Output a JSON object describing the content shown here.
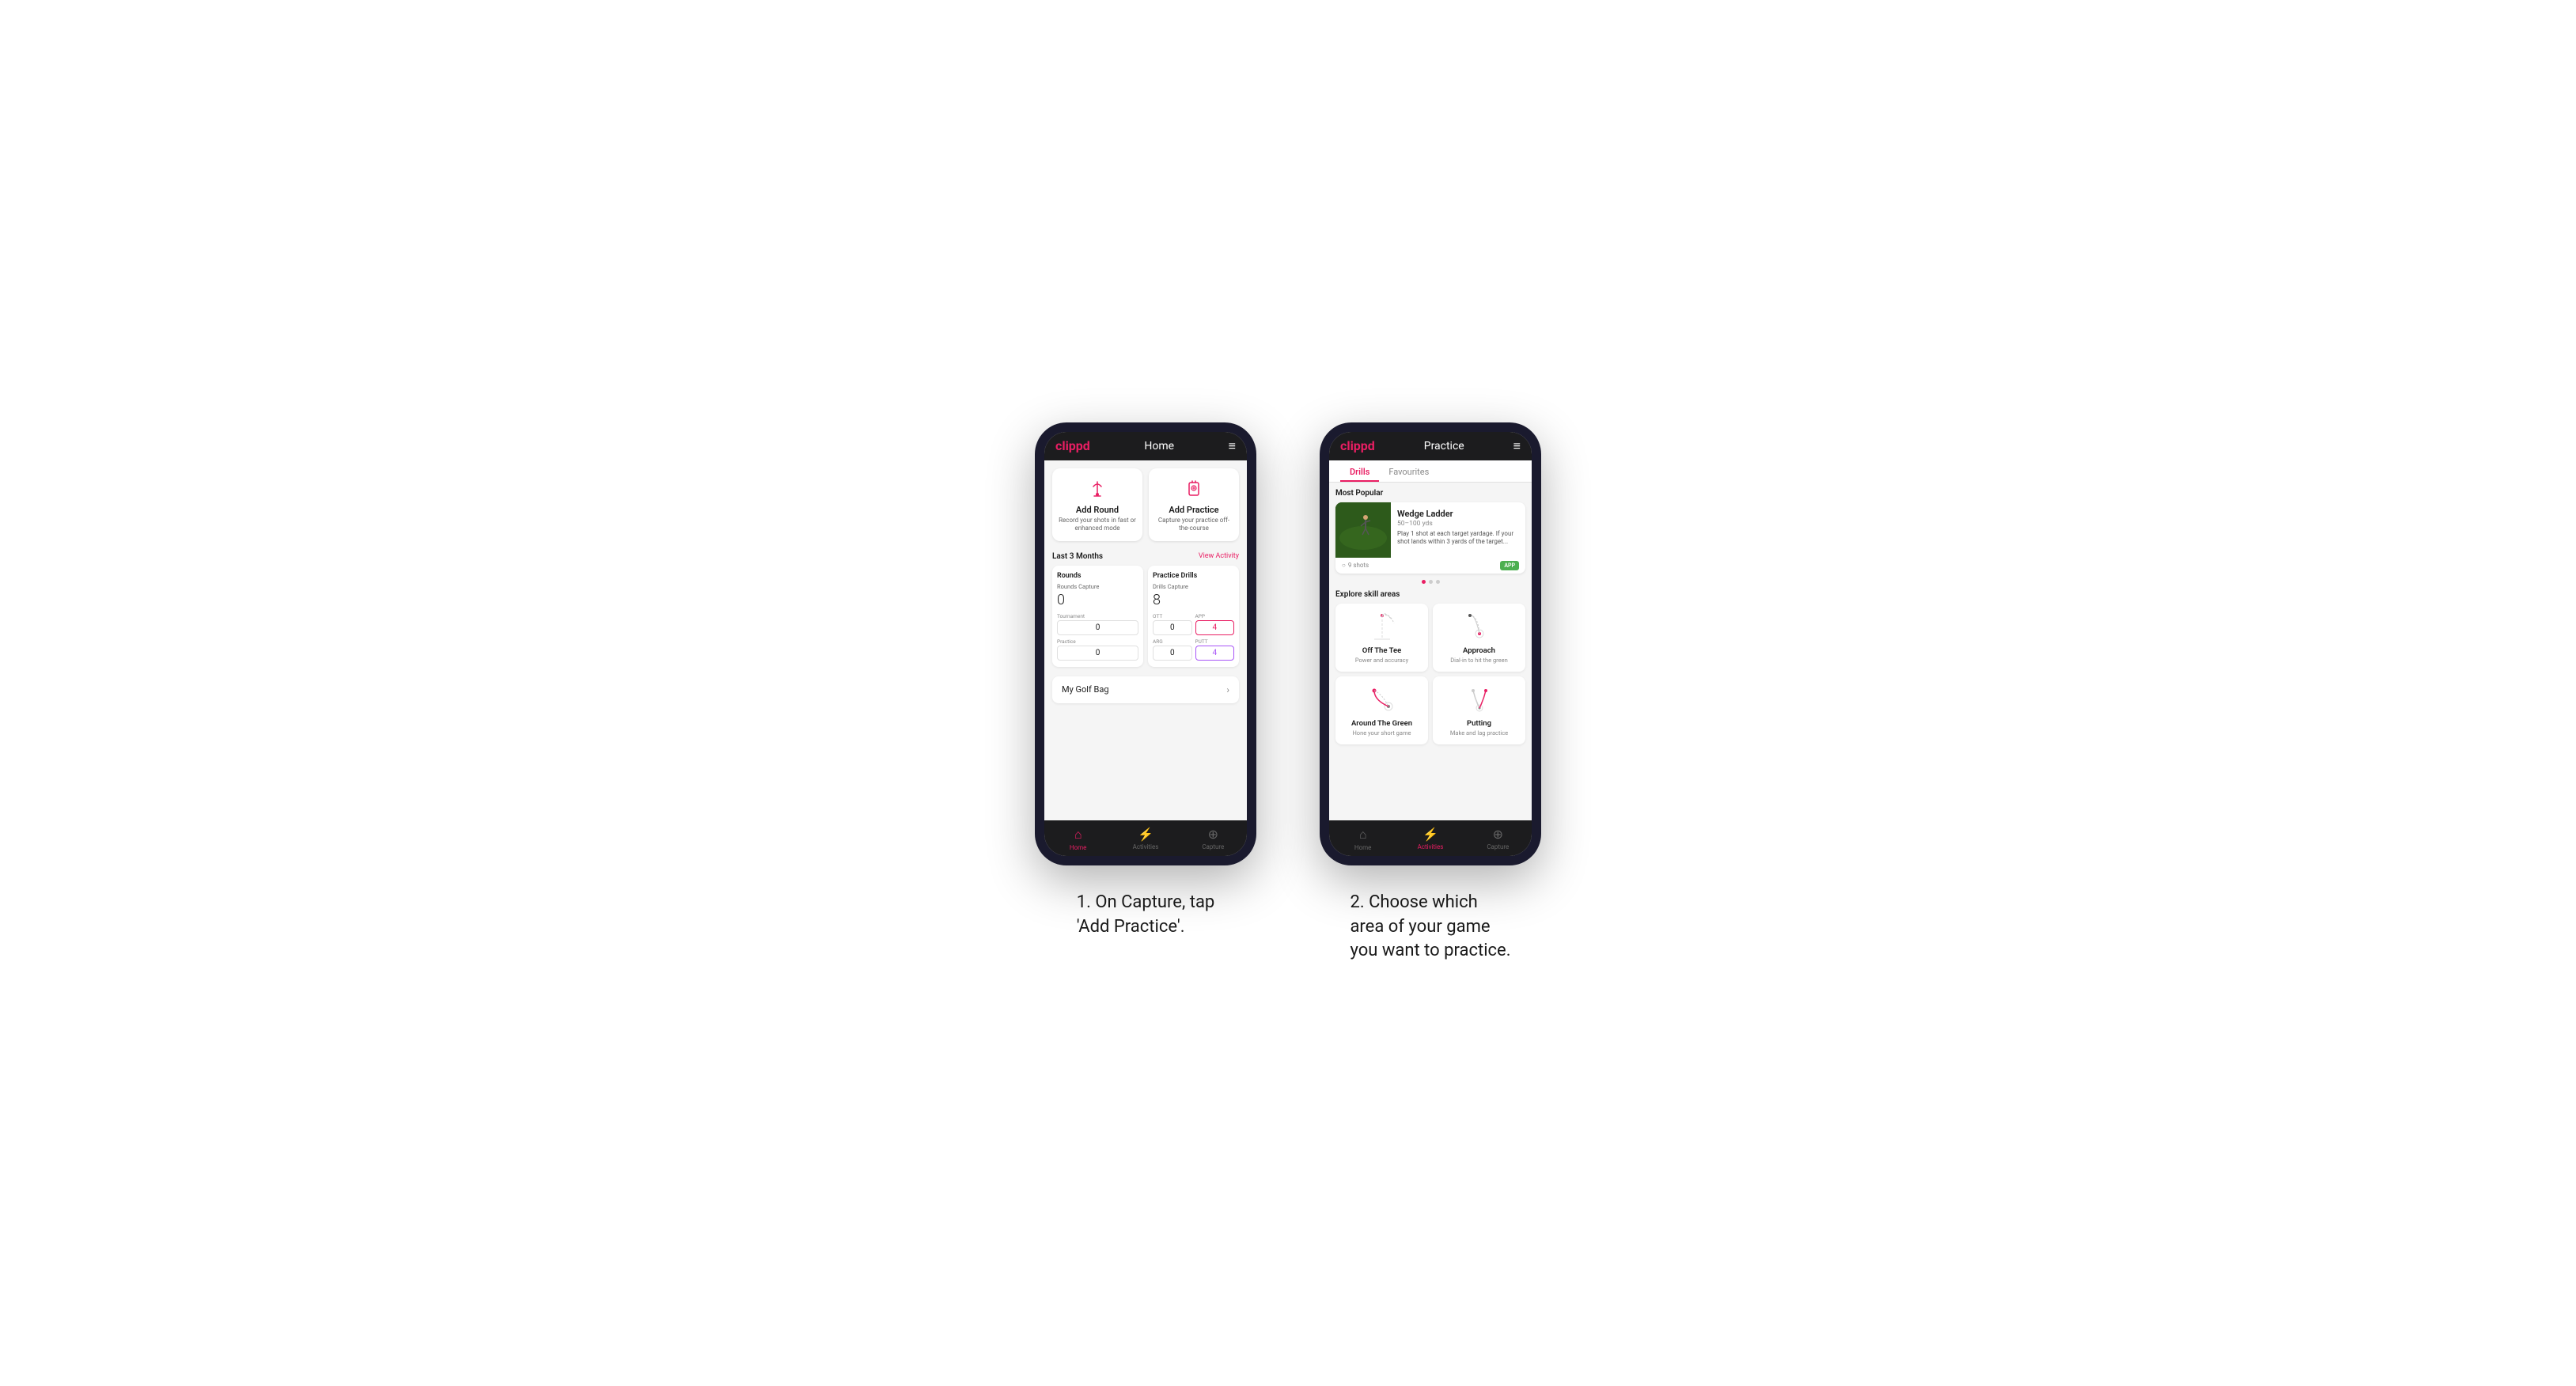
{
  "page": {
    "background": "#ffffff"
  },
  "phone1": {
    "header": {
      "logo": "clippd",
      "title": "Home",
      "menu_icon": "≡"
    },
    "action_cards": [
      {
        "id": "add-round",
        "title": "Add Round",
        "description": "Record your shots in fast or enhanced mode"
      },
      {
        "id": "add-practice",
        "title": "Add Practice",
        "description": "Capture your practice off-the-course"
      }
    ],
    "stats_section": {
      "header": "Last 3 Months",
      "view_activity": "View Activity",
      "rounds_box": {
        "title": "Rounds",
        "label": "Rounds Capture",
        "value": "0",
        "sub_items": [
          {
            "label": "Tournament",
            "value": "0"
          },
          {
            "label": "",
            "value": ""
          },
          {
            "label": "Practice",
            "value": "0"
          }
        ]
      },
      "practice_box": {
        "title": "Practice Drills",
        "label": "Drills Capture",
        "value": "8",
        "sub_items": [
          {
            "label": "OTT",
            "value": "0"
          },
          {
            "label": "APP",
            "value": "4",
            "highlight": true
          },
          {
            "label": "ARG",
            "value": "0"
          },
          {
            "label": "PUTT",
            "value": "4",
            "highlight_purple": true
          }
        ]
      }
    },
    "golf_bag": {
      "label": "My Golf Bag"
    },
    "bottom_nav": [
      {
        "id": "home",
        "label": "Home",
        "active": true
      },
      {
        "id": "activities",
        "label": "Activities",
        "active": false
      },
      {
        "id": "capture",
        "label": "Capture",
        "active": false
      }
    ]
  },
  "phone2": {
    "header": {
      "logo": "clippd",
      "title": "Practice",
      "menu_icon": "≡"
    },
    "tabs": [
      {
        "label": "Drills",
        "active": true
      },
      {
        "label": "Favourites",
        "active": false
      }
    ],
    "most_popular": {
      "section_title": "Most Popular",
      "featured": {
        "title": "Wedge Ladder",
        "subtitle": "50–100 yds",
        "description": "Play 1 shot at each target yardage. If your shot lands within 3 yards of the target...",
        "shots": "9 shots",
        "badge": "APP"
      }
    },
    "skill_areas": {
      "section_title": "Explore skill areas",
      "items": [
        {
          "id": "off-the-tee",
          "title": "Off The Tee",
          "description": "Power and accuracy"
        },
        {
          "id": "approach",
          "title": "Approach",
          "description": "Dial-in to hit the green"
        },
        {
          "id": "around-the-green",
          "title": "Around The Green",
          "description": "Hone your short game"
        },
        {
          "id": "putting",
          "title": "Putting",
          "description": "Make and lag practice"
        }
      ]
    },
    "bottom_nav": [
      {
        "id": "home",
        "label": "Home",
        "active": false
      },
      {
        "id": "activities",
        "label": "Activities",
        "active": true
      },
      {
        "id": "capture",
        "label": "Capture",
        "active": false
      }
    ]
  },
  "captions": {
    "caption1": "1. On Capture, tap\n'Add Practice'.",
    "caption2": "2. Choose which\narea of your game\nyou want to practice."
  }
}
